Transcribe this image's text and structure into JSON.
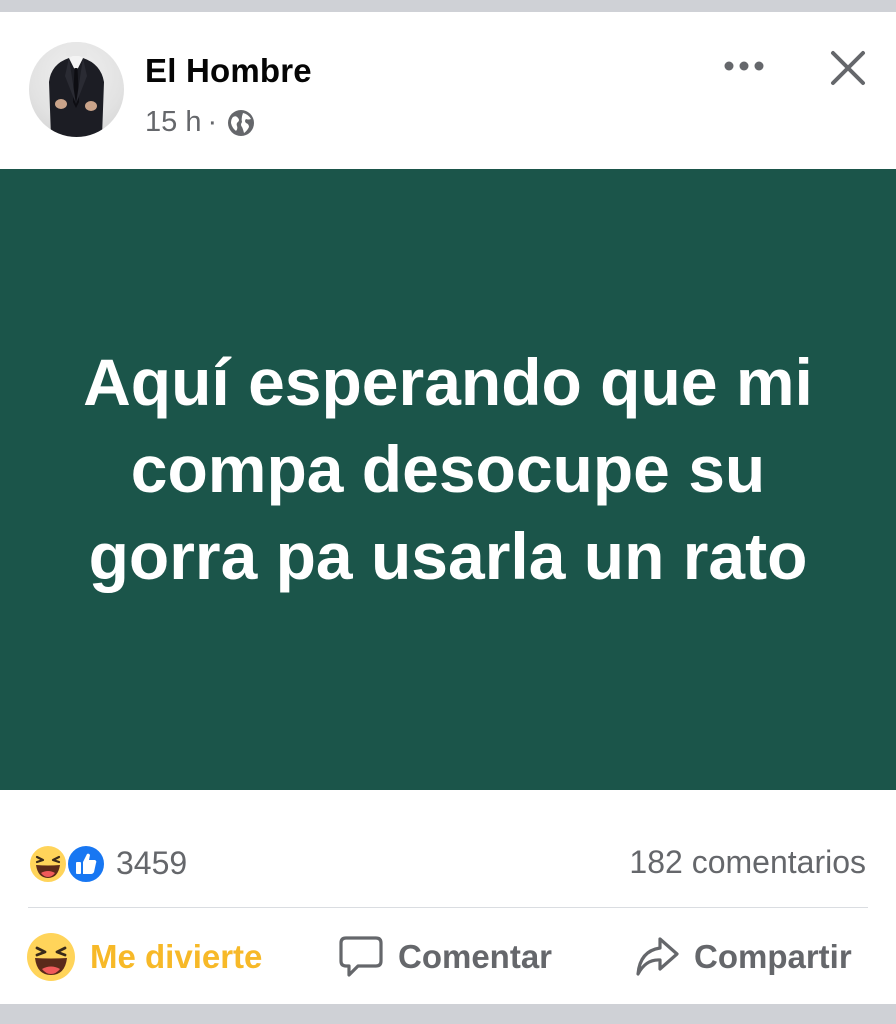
{
  "post": {
    "author": "El Hombre",
    "time": "15 h",
    "separator": "·",
    "audience_icon": "globe-icon",
    "text": "Aquí esperando que mi compa desocupe su gorra pa usarla un rato",
    "background_color": "#1b554a"
  },
  "reactions": {
    "icons": [
      "haha-reaction-icon",
      "like-reaction-icon"
    ],
    "count": "3459",
    "comments": "182 comentarios"
  },
  "actions": {
    "react_label": "Me divierte",
    "react_color": "#f7b928",
    "comment_label": "Comentar",
    "share_label": "Compartir"
  }
}
